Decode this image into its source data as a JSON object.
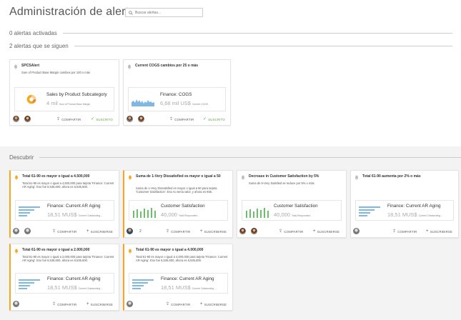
{
  "header": {
    "title": "Administración de alertas",
    "search_placeholder": "Buscar alertas..."
  },
  "sections": {
    "activated": "0 alertas activadas",
    "followed": "2 alertas que se siguen",
    "discover": "Descubrir"
  },
  "followed_cards": [
    {
      "title": "SPCSAlert",
      "desc": "Sum of Product Base Margin cambios por 100 o más",
      "tile_name": "Sales by Product Subcategory",
      "tile_value": "4 mil",
      "tile_sub": "Sum of Product Base Margin",
      "action1": "COMPARTIR",
      "action2": "SUSCRITO"
    },
    {
      "title": "Current COGS cambios por 25 o más",
      "desc": "",
      "tile_name": "Finance: COGS",
      "tile_value": "6,68 mil US$",
      "tile_sub": "Current COGS",
      "action1": "COMPARTIR",
      "action2": "SUSCRITO"
    }
  ],
  "discover_cards": [
    {
      "title": "Total 61-90 es mayor o igual a 4.500,000",
      "desc": "Total 61-90 es mayor o igual a 4,500,000 para tarjeta 'Finance: Current AR Aging'. Eso fue 6,536,600, ahora es 6,536,600.",
      "tile_name": "Finance: Current AR Aging",
      "tile_value": "18,51 MUS$",
      "tile_sub": "Current Outstanding ...",
      "action1": "COMPARTIR",
      "action2": "SUSCRIBIRSE"
    },
    {
      "title": "Suma de 1-Very Dissatisfied es mayor o igual a 50",
      "desc": "Suma de 1-Very Dissatisfied es mayor o igual a 50 para tarjeta 'Customer Satisfaction'. Eso no tenía valor, y ahora es 655.",
      "tile_name": "Customer Satisfaction",
      "tile_value": "40,000",
      "tile_sub": "Total Responders",
      "count": "2",
      "action1": "COMPARTIR",
      "action2": "SUSCRIBIRSE"
    },
    {
      "title": "Decrease in Customer Satisfaction by 5%",
      "desc": "Suma de 5-Very Satisfied se reduce por 5% o más",
      "tile_name": "Customer Satisfaction",
      "tile_value": "40,000",
      "tile_sub": "Total Responders",
      "action1": "COMPARTIR",
      "action2": "SUSCRIBIRSE"
    },
    {
      "title": "Total 61-90 aumenta por 2% o más",
      "desc": "",
      "tile_name": "Finance: Current AR Aging",
      "tile_value": "18,51 MUS$",
      "tile_sub": "Current Outstanding ...",
      "action1": "COMPARTIR",
      "action2": "SUSCRIBIRSE"
    },
    {
      "title": "Total 61-90 es mayor o igual a 2.000,000",
      "desc": "Total 61-90 es mayor o igual a 2,000,000 para tarjeta 'Finance: Current AR Aging'. Eso fue 6,536,600, ahora es 6,536,600.",
      "tile_name": "Finance: Current AR Aging",
      "tile_value": "18,51 MUS$",
      "tile_sub": "Current Outstanding ...",
      "action1": "COMPARTIR",
      "action2": "SUSCRIBIRSE"
    },
    {
      "title": "Total 61-90 es mayor o igual a 4.000,000",
      "desc": "Total 61-90 es mayor o igual a 4,000,000 para tarjeta 'Finance: Current AR Aging'. Eso fue 6,536,600, ahora es 6,536,600.",
      "tile_name": "Finance: Current AR Aging",
      "tile_value": "18,51 MUS$",
      "tile_sub": "Current Outstanding ...",
      "action1": "COMPARTIR",
      "action2": "SUSCRIBIRSE"
    }
  ],
  "colors": {
    "accent_orange": "#f5a623",
    "chart_blue": "#7fb8e0",
    "chart_green": "#6abf69",
    "subscribed_green": "#5aa63d"
  }
}
